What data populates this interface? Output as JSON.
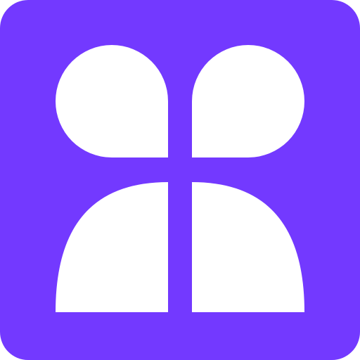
{
  "icon": {
    "name": "app-logo-icon",
    "background_color": "#7339FF",
    "shape_color": "#FFFFFF"
  }
}
